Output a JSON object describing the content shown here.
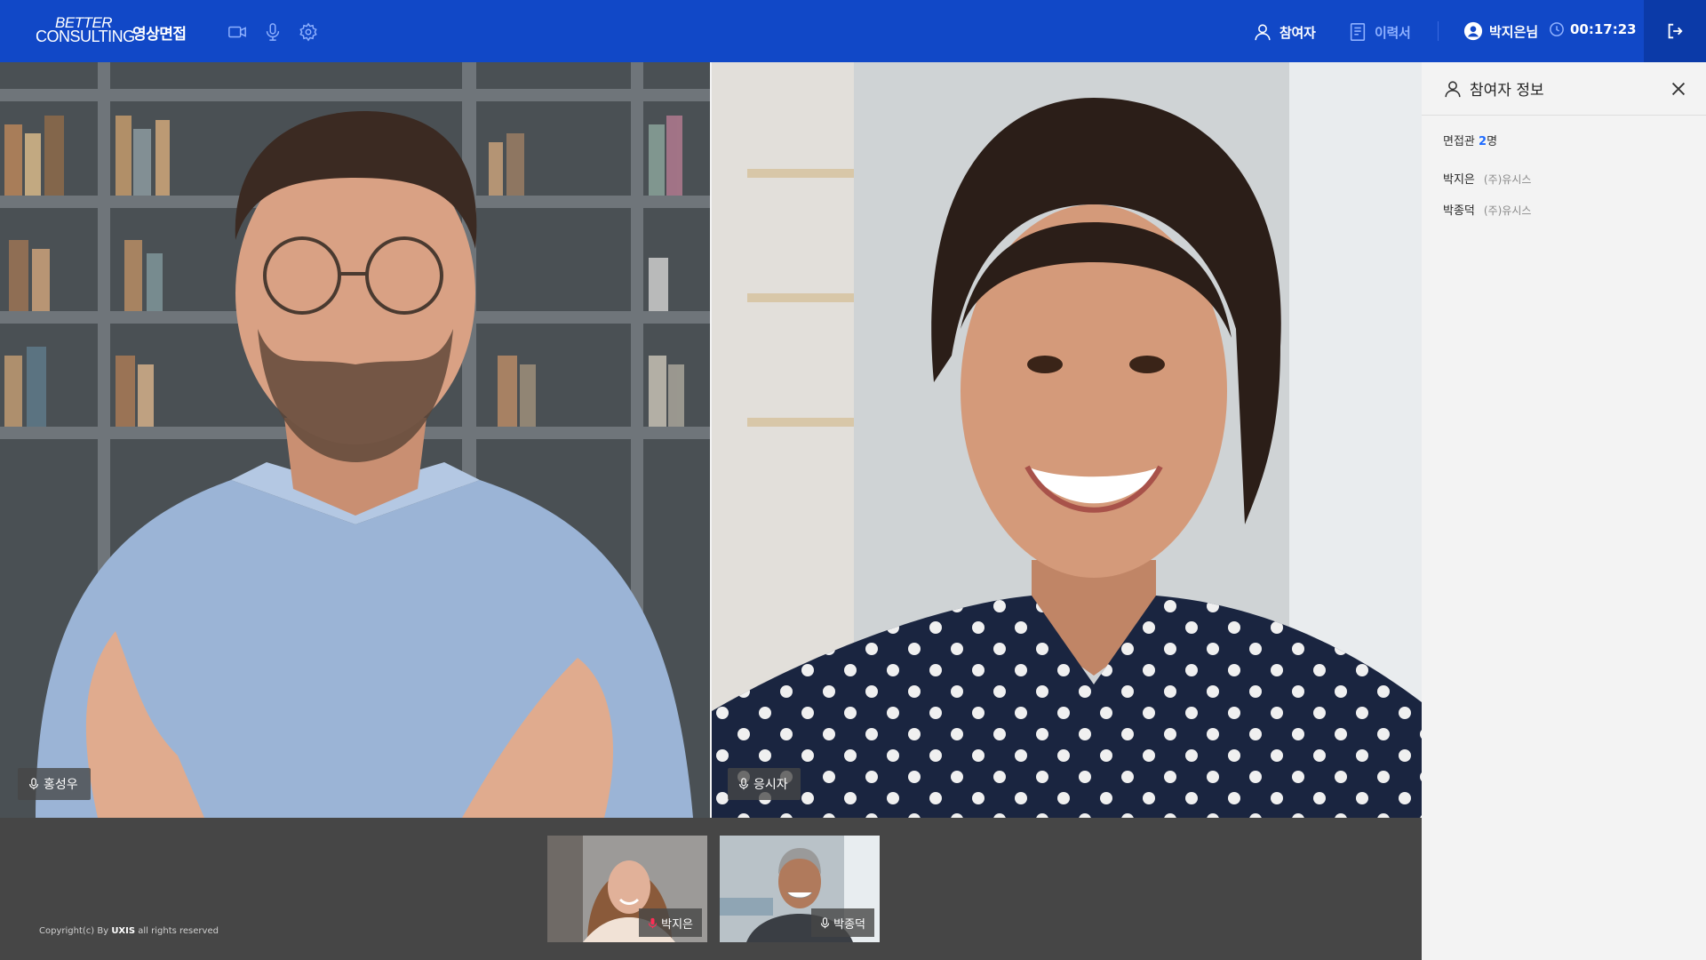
{
  "header": {
    "logo_line1": "BETTER",
    "logo_line2": "CONSULTING",
    "title": "영상면접",
    "tools": [
      "camera-icon",
      "mic-icon",
      "settings-icon"
    ],
    "nav_participants": "참여자",
    "nav_resume": "이력서",
    "user_name": "박지은님",
    "timer": "00:17:23"
  },
  "videos": [
    {
      "name": "홍성우"
    },
    {
      "name": "응시자"
    }
  ],
  "thumbnails": [
    {
      "name": "박지은",
      "mic_active": true
    },
    {
      "name": "박종덕",
      "mic_active": false
    }
  ],
  "footer": {
    "copyright_prefix": "Copyright(c) By ",
    "copyright_brand": "UXIS",
    "copyright_suffix": " all rights reserved"
  },
  "panel": {
    "title": "참여자 정보",
    "count_label": "면접관 ",
    "count_value": "2",
    "count_unit": "명",
    "members": [
      {
        "name": "박지은",
        "company": "(주)유시스"
      },
      {
        "name": "박종덕",
        "company": "(주)유시스"
      }
    ]
  },
  "colors": {
    "header_bg": "#1148c7",
    "exit_bg": "#0b3aa8",
    "accent_blue": "#1e6bff",
    "mic_active_red": "#ff2d55",
    "bottom_bg": "#464646",
    "panel_bg": "#f3f3f3"
  }
}
